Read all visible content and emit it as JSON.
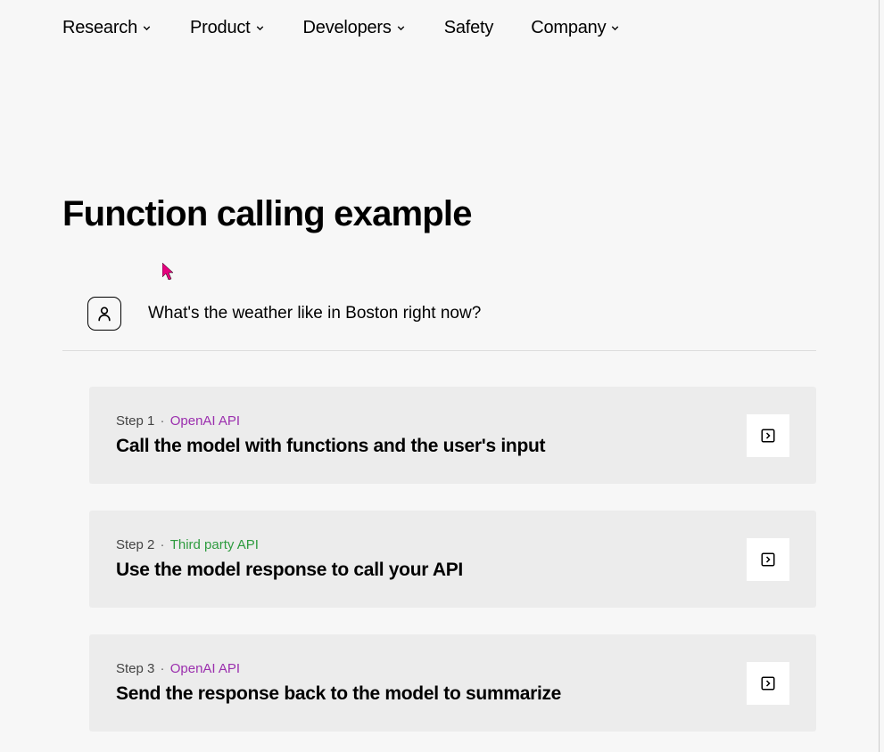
{
  "nav": {
    "items": [
      {
        "label": "Research",
        "has_dropdown": true
      },
      {
        "label": "Product",
        "has_dropdown": true
      },
      {
        "label": "Developers",
        "has_dropdown": true
      },
      {
        "label": "Safety",
        "has_dropdown": false
      },
      {
        "label": "Company",
        "has_dropdown": true
      }
    ]
  },
  "heading": "Function calling example",
  "user_message": "What's the weather like in Boston right now?",
  "steps": [
    {
      "step_label": "Step 1",
      "api_label": "OpenAI API",
      "api_color": "purple",
      "title": "Call the model with functions and the user's input"
    },
    {
      "step_label": "Step 2",
      "api_label": "Third party API",
      "api_color": "green",
      "title": "Use the model response to call your API"
    },
    {
      "step_label": "Step 3",
      "api_label": "OpenAI API",
      "api_color": "purple",
      "title": "Send the response back to the model to summarize"
    }
  ]
}
